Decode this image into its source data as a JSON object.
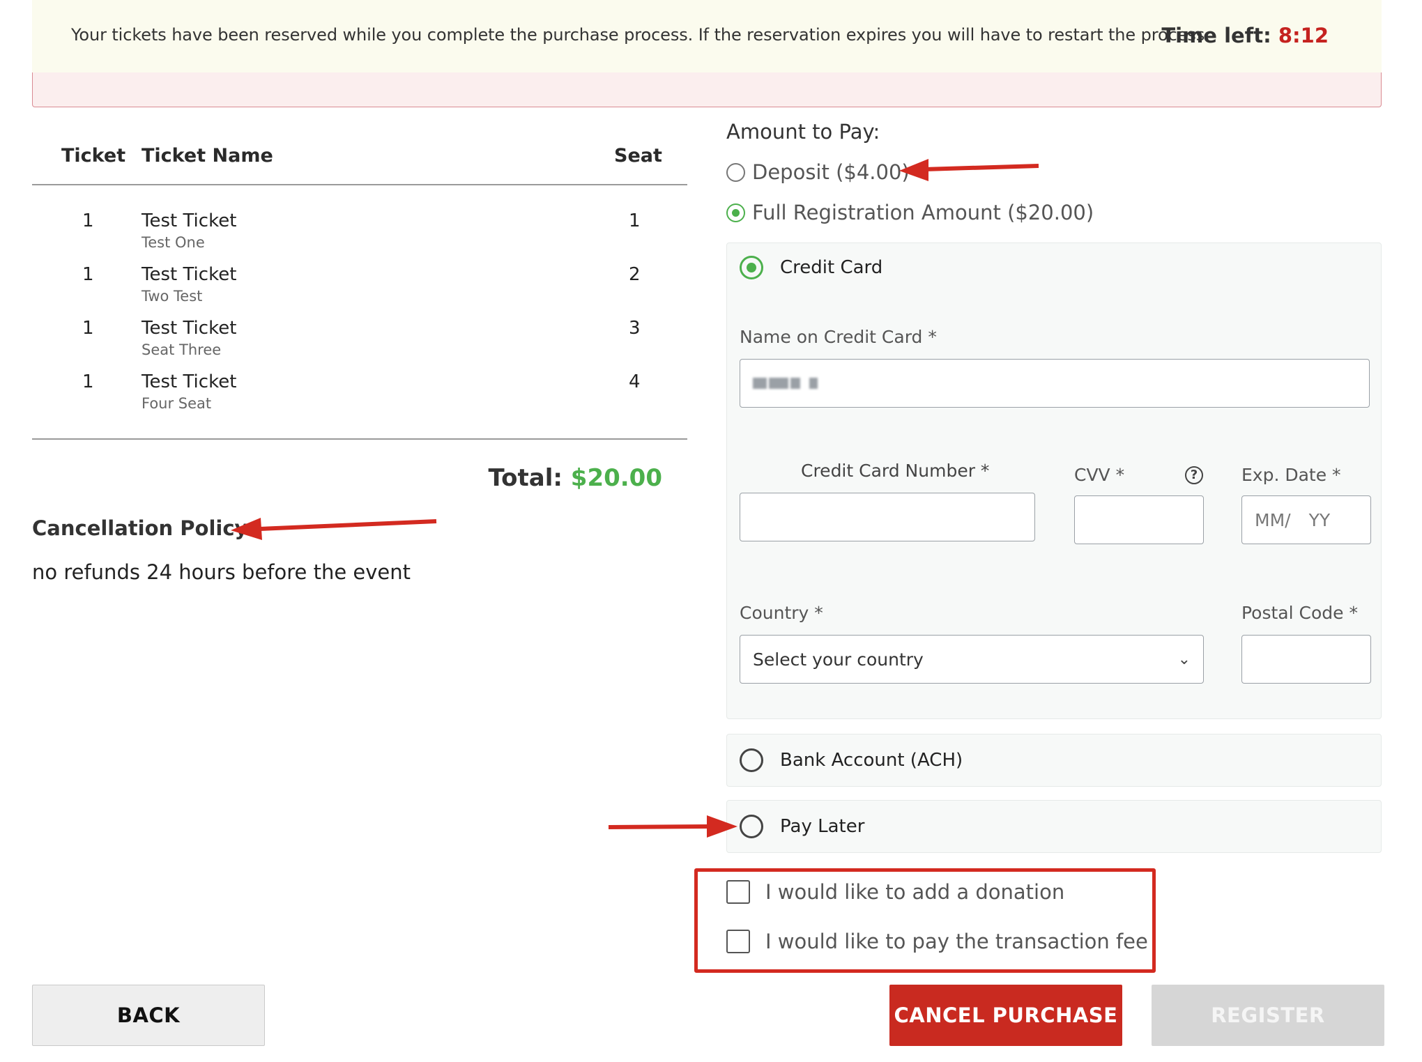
{
  "banner": {
    "message": "Your tickets have been reserved while you complete the purchase process. If the reservation expires you will have to restart the process.",
    "time_left_label": "Time left:",
    "time_left_value": "8:12"
  },
  "tickets": {
    "headers": {
      "ticket": "Ticket",
      "name": "Ticket Name",
      "seat": "Seat"
    },
    "rows": [
      {
        "qty": "1",
        "name": "Test Ticket",
        "sub": "Test One",
        "seat": "1"
      },
      {
        "qty": "1",
        "name": "Test Ticket",
        "sub": "Two Test",
        "seat": "2"
      },
      {
        "qty": "1",
        "name": "Test Ticket",
        "sub": "Seat Three",
        "seat": "3"
      },
      {
        "qty": "1",
        "name": "Test Ticket",
        "sub": "Four Seat",
        "seat": "4"
      }
    ],
    "total_label": "Total:",
    "total_value": "$20.00"
  },
  "cancellation": {
    "title": "Cancellation Policy:",
    "text": "no refunds 24 hours before the event"
  },
  "amount_to_pay": {
    "title": "Amount to Pay:",
    "options": [
      {
        "label": "Deposit ($4.00)",
        "selected": false
      },
      {
        "label": "Full Registration Amount ($20.00)",
        "selected": true
      }
    ]
  },
  "payment_methods": {
    "credit_card": {
      "label": "Credit Card",
      "selected": true,
      "name_label": "Name on Credit Card *",
      "number_label": "Credit Card Number *",
      "cvv_label": "CVV *",
      "exp_label": "Exp. Date *",
      "exp_placeholder_month": "MM/",
      "exp_placeholder_year": "YY",
      "country_label": "Country *",
      "country_value": "Select your country",
      "postal_label": "Postal Code *"
    },
    "bank": {
      "label": "Bank Account (ACH)",
      "selected": false
    },
    "pay_later": {
      "label": "Pay Later",
      "selected": false
    }
  },
  "options": {
    "donation_label": "I would like to add a donation",
    "fee_label": "I would like to pay the transaction fee"
  },
  "buttons": {
    "back": "BACK",
    "cancel": "CANCEL PURCHASE",
    "register": "REGISTER"
  },
  "colors": {
    "accent_green": "#4cb04c",
    "timer_red": "#c5221f",
    "annotation_red": "#d32a20",
    "cancel_button": "#c92a20"
  },
  "icons": {
    "help": "question-circle-icon",
    "dropdown": "chevron-down-icon"
  }
}
